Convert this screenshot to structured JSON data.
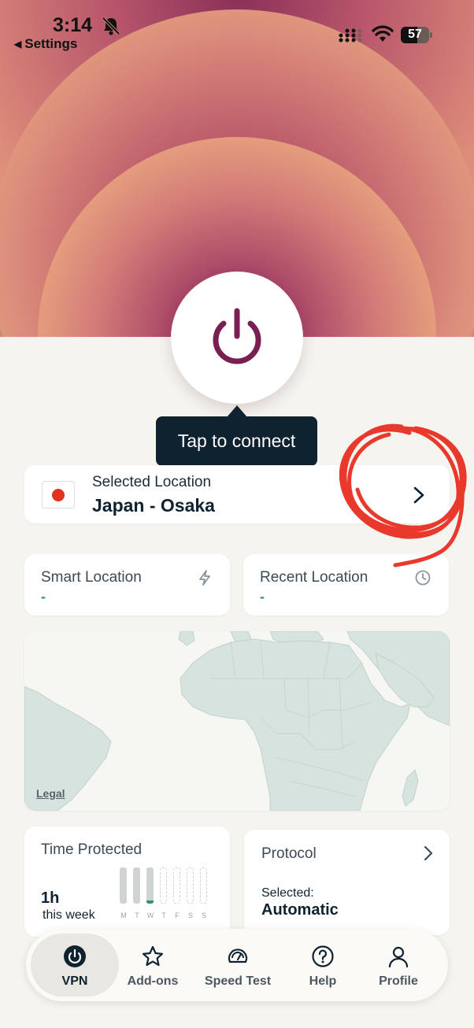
{
  "status_bar": {
    "time": "3:14",
    "back_label": "Settings",
    "battery": "57"
  },
  "power": {
    "tooltip": "Tap to connect"
  },
  "selected_location": {
    "label": "Selected Location",
    "value": "Japan - Osaka"
  },
  "smart_location": {
    "title": "Smart Location",
    "value": "-"
  },
  "recent_location": {
    "title": "Recent Location",
    "value": "-"
  },
  "map": {
    "legal": "Legal"
  },
  "time_protected": {
    "title": "Time Protected",
    "hours": "1h",
    "period": "this week",
    "days": [
      "M",
      "T",
      "W",
      "T",
      "F",
      "S",
      "S"
    ]
  },
  "protocol": {
    "title": "Protocol",
    "selected_label": "Selected:",
    "value": "Automatic"
  },
  "nav": {
    "vpn": "VPN",
    "addons": "Add-ons",
    "speed_test": "Speed Test",
    "help": "Help",
    "profile": "Profile"
  },
  "colors": {
    "accent": "#7a1f52",
    "navy": "#0f2230",
    "teal": "#2e8f7a",
    "annotation": "#e8392c"
  }
}
